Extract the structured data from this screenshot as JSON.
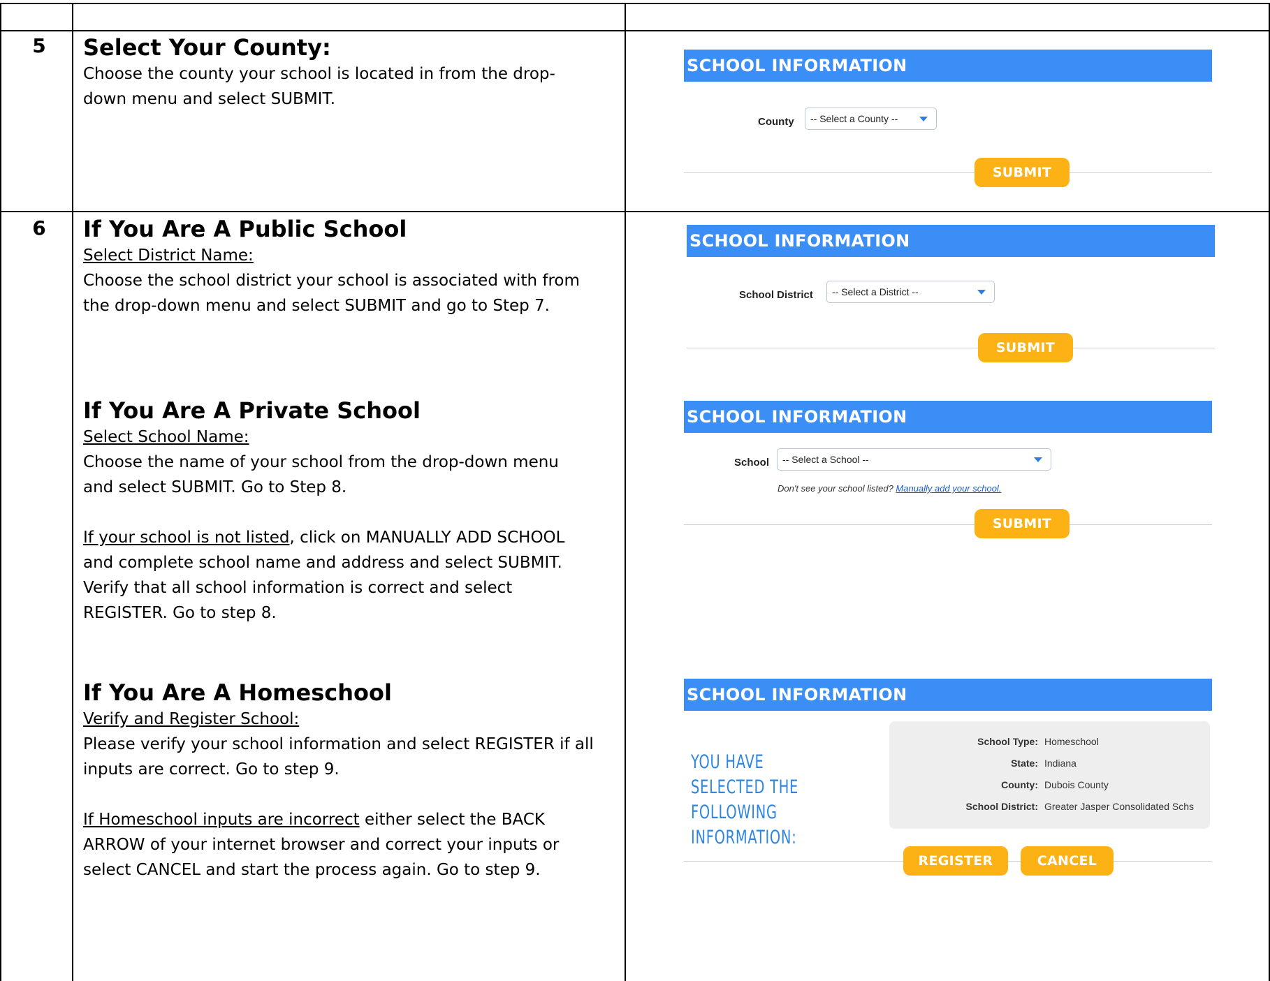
{
  "steps": [
    {
      "number": "5",
      "title": "Select Your County:",
      "body": [
        "Choose the county your school is located in from the drop-",
        "down menu and select SUBMIT."
      ]
    },
    {
      "number": "6",
      "public": {
        "title": "If You Are A Public School",
        "subtitle": "Select District Name:",
        "body": [
          "Choose the school district your school is associated with from",
          "the drop-down menu and select SUBMIT and go to Step 7."
        ]
      },
      "private": {
        "title": "If You Are A Private School",
        "subtitle": "Select School Name:",
        "body": [
          "Choose the name of your school from the drop-down menu",
          "and select SUBMIT. Go to Step 8."
        ],
        "not_listed_lead": "If your school is not listed",
        "not_listed_rest": [
          ", click on MANUALLY ADD SCHOOL",
          "and complete school name and address and select SUBMIT.",
          "Verify that all school information is correct and select",
          "REGISTER. Go to step 8."
        ]
      },
      "home": {
        "title": "If You Are A Homeschool",
        "subtitle": "Verify and Register School:",
        "body": [
          "Please verify your school information and select REGISTER if all",
          "inputs are correct. Go to step 9."
        ],
        "incorrect_lead": "If Homeschool inputs are incorrect",
        "incorrect_rest": [
          " either select the BACK",
          "ARROW of your internet browser and correct your inputs or",
          "select CANCEL and start the process again. Go to step 9."
        ]
      }
    }
  ],
  "forms": {
    "band_title": "SCHOOL INFORMATION",
    "submit_label": "SUBMIT",
    "county": {
      "label": "County",
      "value": "-- Select a County --"
    },
    "district": {
      "label": "School District",
      "value": "-- Select a District --"
    },
    "school": {
      "label": "School",
      "value": "-- Select a School --",
      "note_lead": "Don't see your school listed? ",
      "note_link": "Manually add your school."
    },
    "home": {
      "heading_line1": "You have selected the",
      "heading_line2": "following information:",
      "rows": [
        {
          "key": "School Type:",
          "value": "Homeschool"
        },
        {
          "key": "State:",
          "value": "Indiana"
        },
        {
          "key": "County:",
          "value": "Dubois County"
        },
        {
          "key": "School District:",
          "value": "Greater Jasper Consolidated Schs"
        }
      ],
      "register_label": "REGISTER",
      "cancel_label": "CANCEL"
    }
  },
  "colors": {
    "band": "#3a8ef6",
    "button": "#fcb214",
    "heading": "#2e86e0"
  }
}
